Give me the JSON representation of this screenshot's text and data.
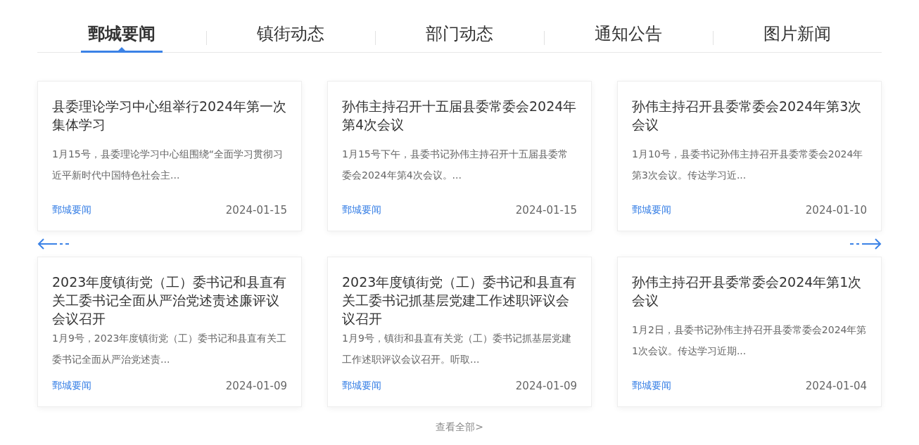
{
  "tabs": [
    {
      "label": "鄄城要闻",
      "selected": true
    },
    {
      "label": "镇街动态",
      "selected": false
    },
    {
      "label": "部门动态",
      "selected": false
    },
    {
      "label": "通知公告",
      "selected": false
    },
    {
      "label": "图片新闻",
      "selected": false
    }
  ],
  "cards": [
    {
      "title": "县委理论学习中心组举行2024年第一次集体学习",
      "summary": "1月15号，县委理论学习中心组围绕“全面学习贯彻习近平新时代中国特色社会主...",
      "category": "鄄城要闻",
      "date": "2024-01-15"
    },
    {
      "title": "孙伟主持召开十五届县委常委会2024年第4次会议",
      "summary": "1月15号下午，县委书记孙伟主持召开十五届县委常委会2024年第4次会议。...",
      "category": "鄄城要闻",
      "date": "2024-01-15"
    },
    {
      "title": "孙伟主持召开县委常委会2024年第3次会议",
      "summary": "1月10号，县委书记孙伟主持召开县委常委会2024年第3次会议。传达学习近...",
      "category": "鄄城要闻",
      "date": "2024-01-10"
    },
    {
      "title": "2023年度镇街党（工）委书记和县直有关工委书记全面从严治党述责述廉评议会议召开",
      "summary": "1月9号，2023年度镇街党（工）委书记和县直有关工委书记全面从严治党述责...",
      "category": "鄄城要闻",
      "date": "2024-01-09"
    },
    {
      "title": "2023年度镇街党（工）委书记和县直有关工委书记抓基层党建工作述职评议会议召开",
      "summary": "1月9号，镇街和县直有关党（工）委书记抓基层党建工作述职评议会议召开。听取...",
      "category": "鄄城要闻",
      "date": "2024-01-09"
    },
    {
      "title": "孙伟主持召开县委常委会2024年第1次会议",
      "summary": "1月2日，县委书记孙伟主持召开县委常委会2024年第1次会议。传达学习近期...",
      "category": "鄄城要闻",
      "date": "2024-01-04"
    }
  ],
  "view_all": "查看全部>"
}
